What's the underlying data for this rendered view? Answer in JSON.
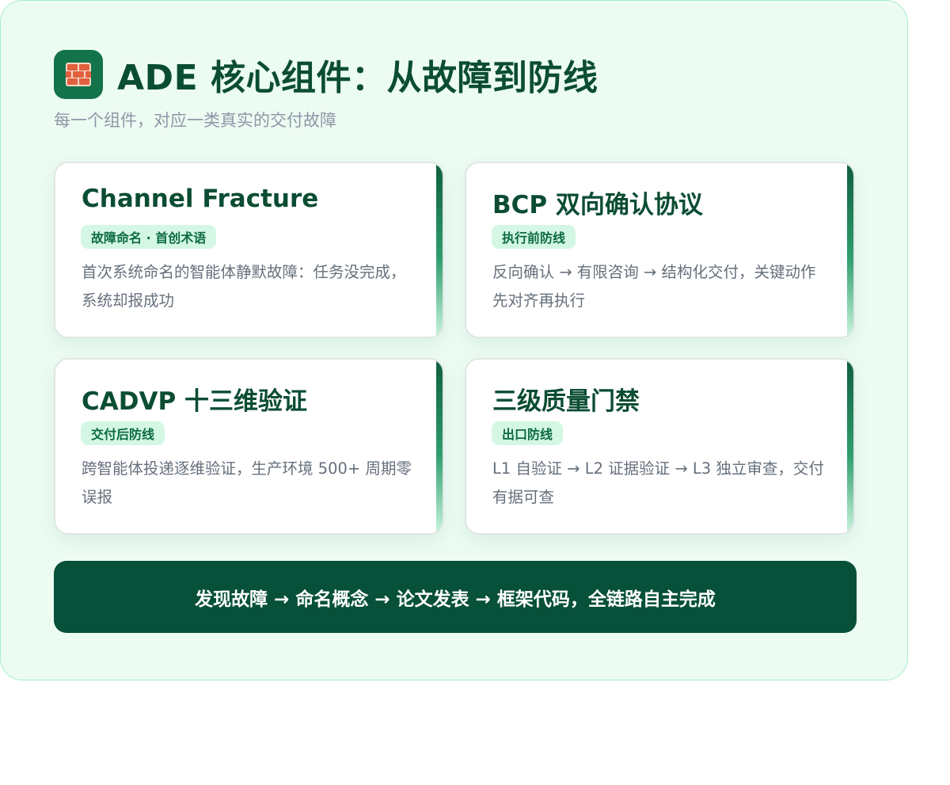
{
  "header": {
    "icon": "brick-wall-icon",
    "title": "ADE 核心组件：从故障到防线",
    "subtitle": "每一个组件，对应一类真实的交付故障"
  },
  "cards": [
    {
      "title": "Channel Fracture",
      "tag": "故障命名 · 首创术语",
      "description": "首次系统命名的智能体静默故障：任务没完成，系统却报成功"
    },
    {
      "title": "BCP 双向确认协议",
      "tag": "执行前防线",
      "description": "反向确认 → 有限咨询 → 结构化交付，关键动作先对齐再执行"
    },
    {
      "title": "CADVP 十三维验证",
      "tag": "交付后防线",
      "description": "跨智能体投递逐维验证，生产环境 500+ 周期零误报"
    },
    {
      "title": "三级质量门禁",
      "tag": "出口防线",
      "description": "L1 自验证 → L2 证据验证 → L3 独立审查，交付有据可查"
    }
  ],
  "banner": {
    "text": "发现故障 → 命名概念 → 论文发表 → 框架代码，全链路自主完成"
  },
  "colors": {
    "panel_background": "#ecfcf3",
    "primary_dark_green": "#0b4d33",
    "banner_background": "#07503a",
    "tag_background": "#d3f7e4",
    "icon_background": "#13734a"
  }
}
